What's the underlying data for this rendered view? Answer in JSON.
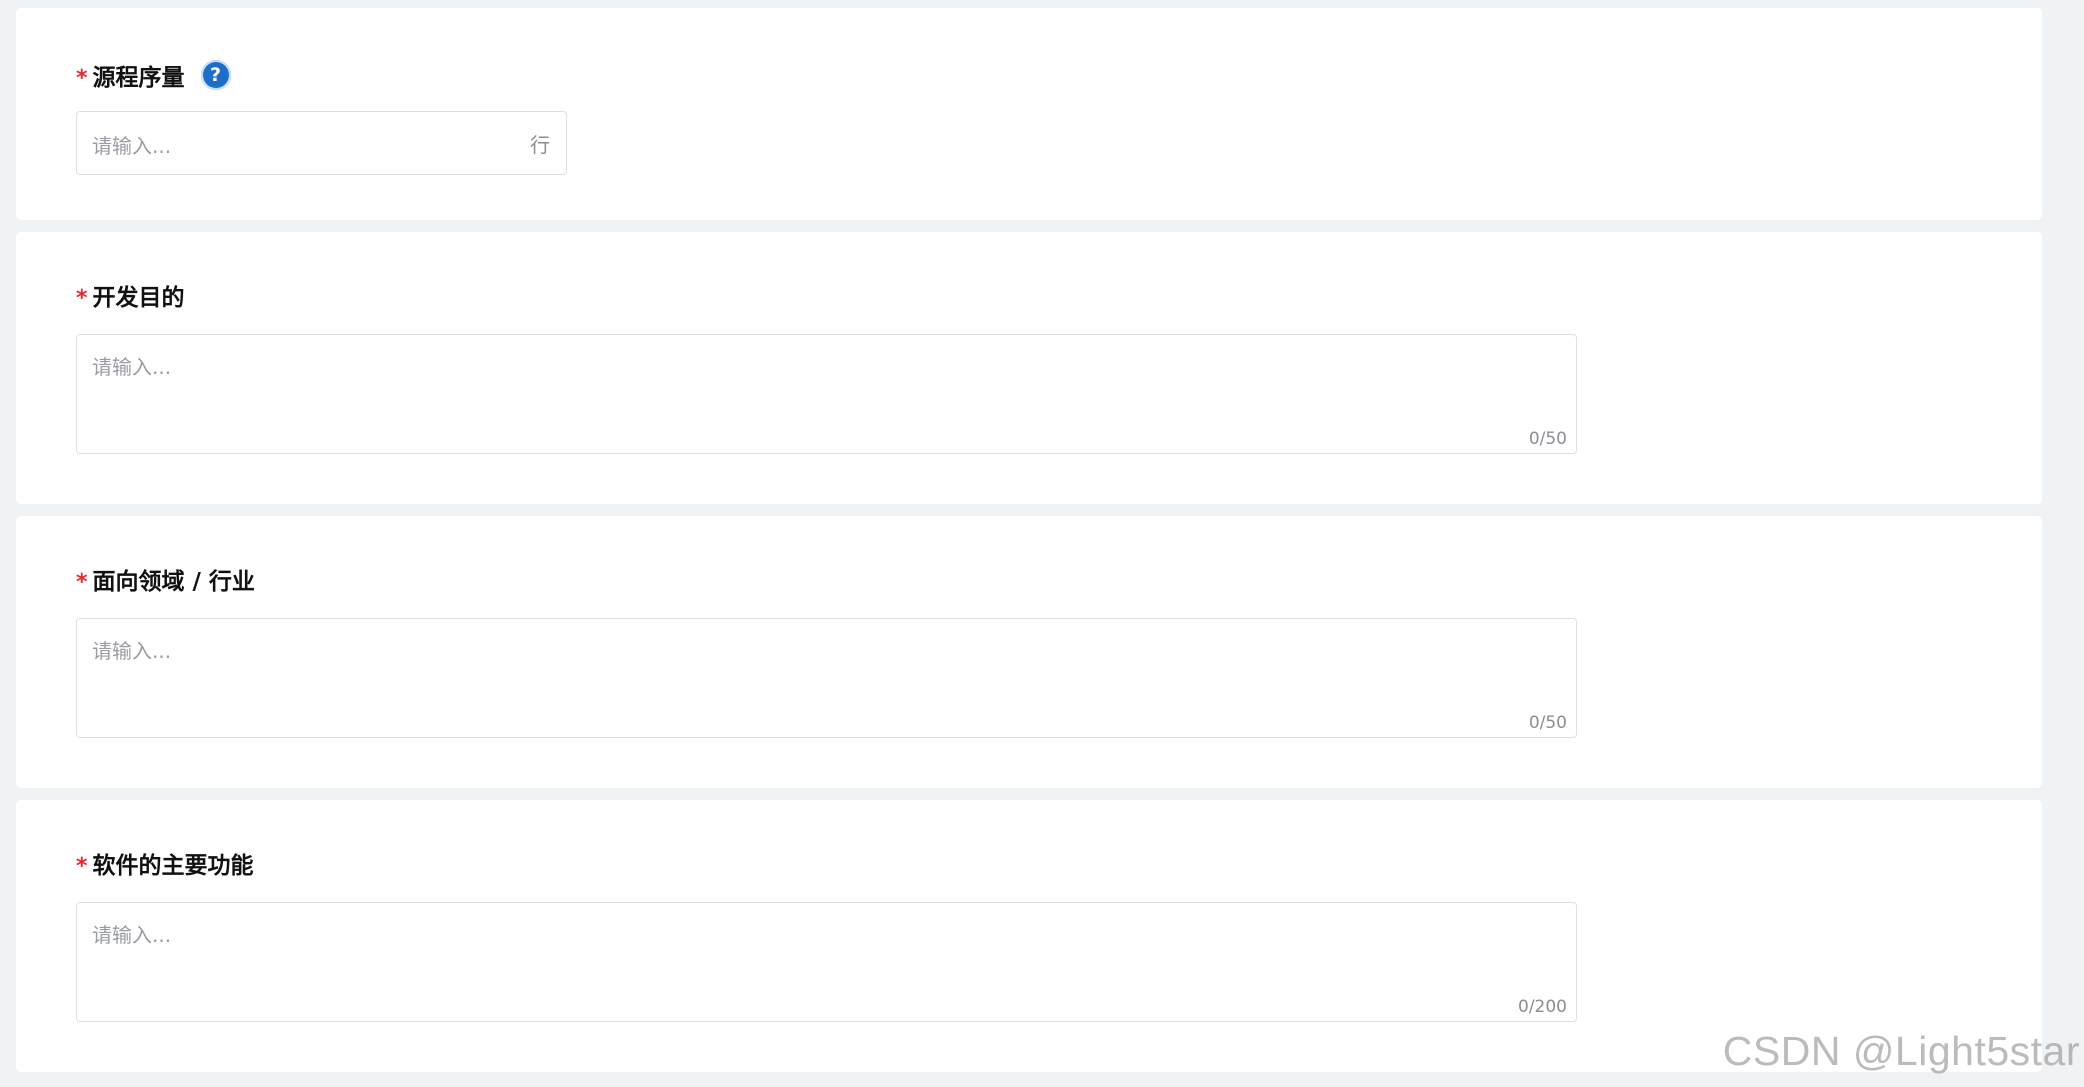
{
  "form": {
    "sections": [
      {
        "required_mark": "*",
        "label": "源程序量",
        "help_icon": "?",
        "input": {
          "placeholder": "请输入...",
          "value": "",
          "suffix": "行"
        }
      },
      {
        "required_mark": "*",
        "label": "开发目的",
        "textarea": {
          "placeholder": "请输入...",
          "value": "",
          "counter": "0/50"
        }
      },
      {
        "required_mark": "*",
        "label": "面向领域 / 行业",
        "textarea": {
          "placeholder": "请输入...",
          "value": "",
          "counter": "0/50"
        }
      },
      {
        "required_mark": "*",
        "label": "软件的主要功能",
        "textarea": {
          "placeholder": "请输入...",
          "value": "",
          "counter": "0/200"
        }
      }
    ]
  },
  "watermark": "CSDN @Light5star",
  "colors": {
    "background": "#f0f3f6",
    "card": "#ffffff",
    "required": "#e8262d",
    "help_icon": "#1d6ec9",
    "border": "#dcdfe6",
    "placeholder": "#9a9ca3"
  },
  "icons": {
    "help": "question-circle-icon"
  }
}
